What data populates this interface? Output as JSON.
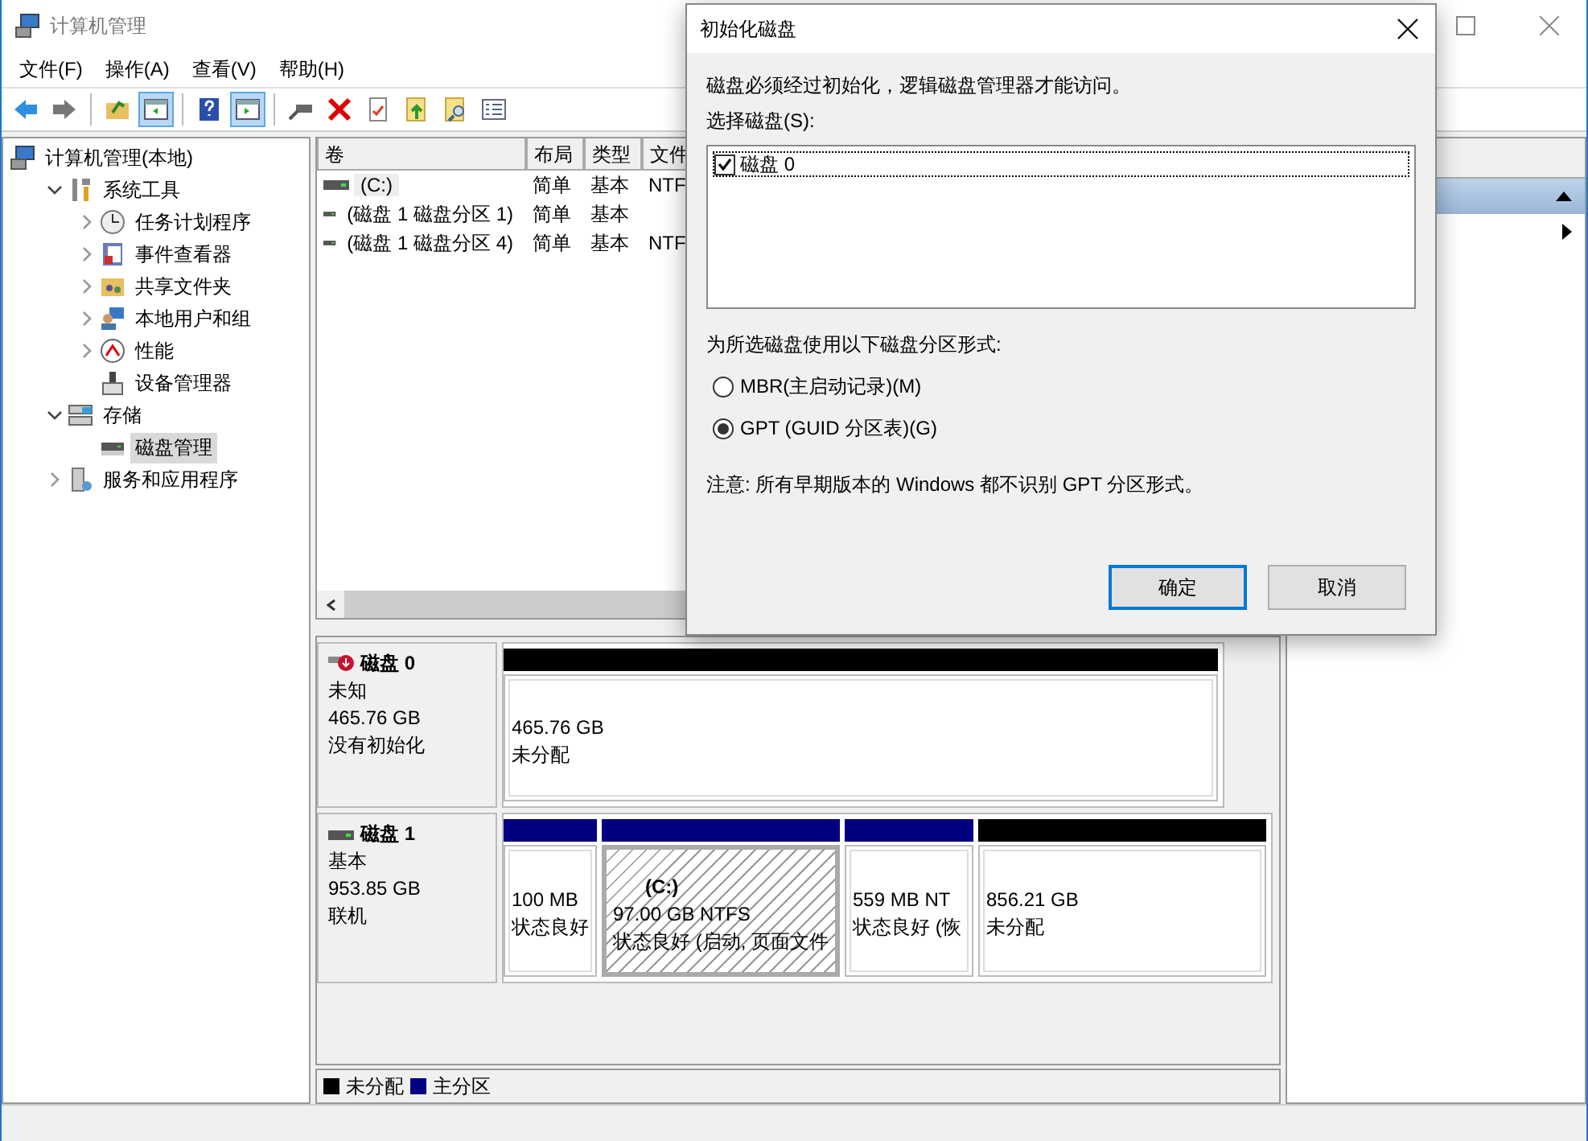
{
  "window": {
    "title": "计算机管理"
  },
  "menu": [
    "文件(F)",
    "操作(A)",
    "查看(V)",
    "帮助(H)"
  ],
  "toolbar": [
    {
      "kind": "back",
      "pressed": false
    },
    {
      "kind": "forward",
      "pressed": false
    },
    {
      "kind": "up-folder",
      "pressed": false
    },
    {
      "kind": "pane",
      "pressed": true
    },
    {
      "kind": "help",
      "pressed": false
    },
    {
      "kind": "pane-right",
      "pressed": true
    },
    {
      "kind": "connect",
      "pressed": false
    },
    {
      "kind": "delete",
      "pressed": false
    },
    {
      "kind": "properties",
      "pressed": false
    },
    {
      "kind": "export",
      "pressed": false
    },
    {
      "kind": "find",
      "pressed": false
    },
    {
      "kind": "checklist",
      "pressed": false
    }
  ],
  "tree": [
    {
      "label": "计算机管理(本地)",
      "kind": "computer",
      "selected": false,
      "children": [
        {
          "label": "系统工具",
          "kind": "tools",
          "expanded": true,
          "selected": false,
          "children": [
            {
              "label": "任务计划程序",
              "kind": "clock",
              "expanded": false,
              "selected": false
            },
            {
              "label": "事件查看器",
              "kind": "event",
              "expanded": false,
              "selected": false
            },
            {
              "label": "共享文件夹",
              "kind": "share",
              "expanded": false,
              "selected": false
            },
            {
              "label": "本地用户和组",
              "kind": "users",
              "expanded": false,
              "selected": false
            },
            {
              "label": "性能",
              "kind": "perf",
              "expanded": false,
              "selected": false
            },
            {
              "label": "设备管理器",
              "kind": "device",
              "selected": false
            }
          ]
        },
        {
          "label": "存储",
          "kind": "storage",
          "expanded": true,
          "selected": false,
          "children": [
            {
              "label": "磁盘管理",
              "kind": "disk",
              "selected": true
            }
          ]
        },
        {
          "label": "服务和应用程序",
          "kind": "services",
          "expanded": false,
          "selected": false
        }
      ]
    }
  ],
  "volumes": {
    "columns": [
      "卷",
      "布局",
      "类型",
      "文件"
    ],
    "rows": [
      {
        "cells": [
          "(C:)",
          "简单",
          "基本",
          "NTF"
        ],
        "selected": true
      },
      {
        "cells": [
          "(磁盘 1 磁盘分区 1)",
          "简单",
          "基本",
          ""
        ],
        "selected": false
      },
      {
        "cells": [
          "(磁盘 1 磁盘分区 4)",
          "简单",
          "基本",
          "NTF"
        ],
        "selected": false
      }
    ]
  },
  "disks": [
    {
      "name": "磁盘 0",
      "kind": "error",
      "lines": [
        "未知",
        "465.76 GB",
        "没有初始化"
      ],
      "partitions": [
        {
          "kind": "unallocated",
          "size": "465.76 GB",
          "state": "未分配",
          "selected": false
        }
      ]
    },
    {
      "name": "磁盘 1",
      "kind": "online",
      "lines": [
        "基本",
        "953.85 GB",
        "联机"
      ],
      "partitions": [
        {
          "kind": "primary",
          "size": "100 MB",
          "state": "状态良好",
          "selected": false
        },
        {
          "kind": "primary",
          "label": "(C:)",
          "size": "97.00 GB NTFS",
          "state": "状态良好 (启动, 页面文件",
          "selected": true
        },
        {
          "kind": "primary",
          "size": "559 MB NT",
          "state": "状态良好 (恢",
          "selected": false
        },
        {
          "kind": "unallocated",
          "size": "856.21 GB",
          "state": "未分配",
          "selected": false
        }
      ]
    }
  ],
  "legend": [
    {
      "label": "未分配",
      "color": "#000000"
    },
    {
      "label": "主分区",
      "color": "#000080"
    }
  ],
  "dialog": {
    "title": "初始化磁盘",
    "message": "磁盘必须经过初始化，逻辑磁盘管理器才能访问。",
    "select_label": "选择磁盘(S):",
    "disks": [
      {
        "label": "磁盘 0",
        "checked": true
      }
    ],
    "style_label": "为所选磁盘使用以下磁盘分区形式:",
    "options": [
      {
        "label": "MBR(主启动记录)(M)",
        "selected": false
      },
      {
        "label": "GPT (GUID 分区表)(G)",
        "selected": true
      }
    ],
    "note": "注意: 所有早期版本的 Windows 都不识别 GPT 分区形式。",
    "buttons": [
      {
        "label": "确定",
        "default": true
      },
      {
        "label": "取消",
        "default": false
      }
    ]
  }
}
